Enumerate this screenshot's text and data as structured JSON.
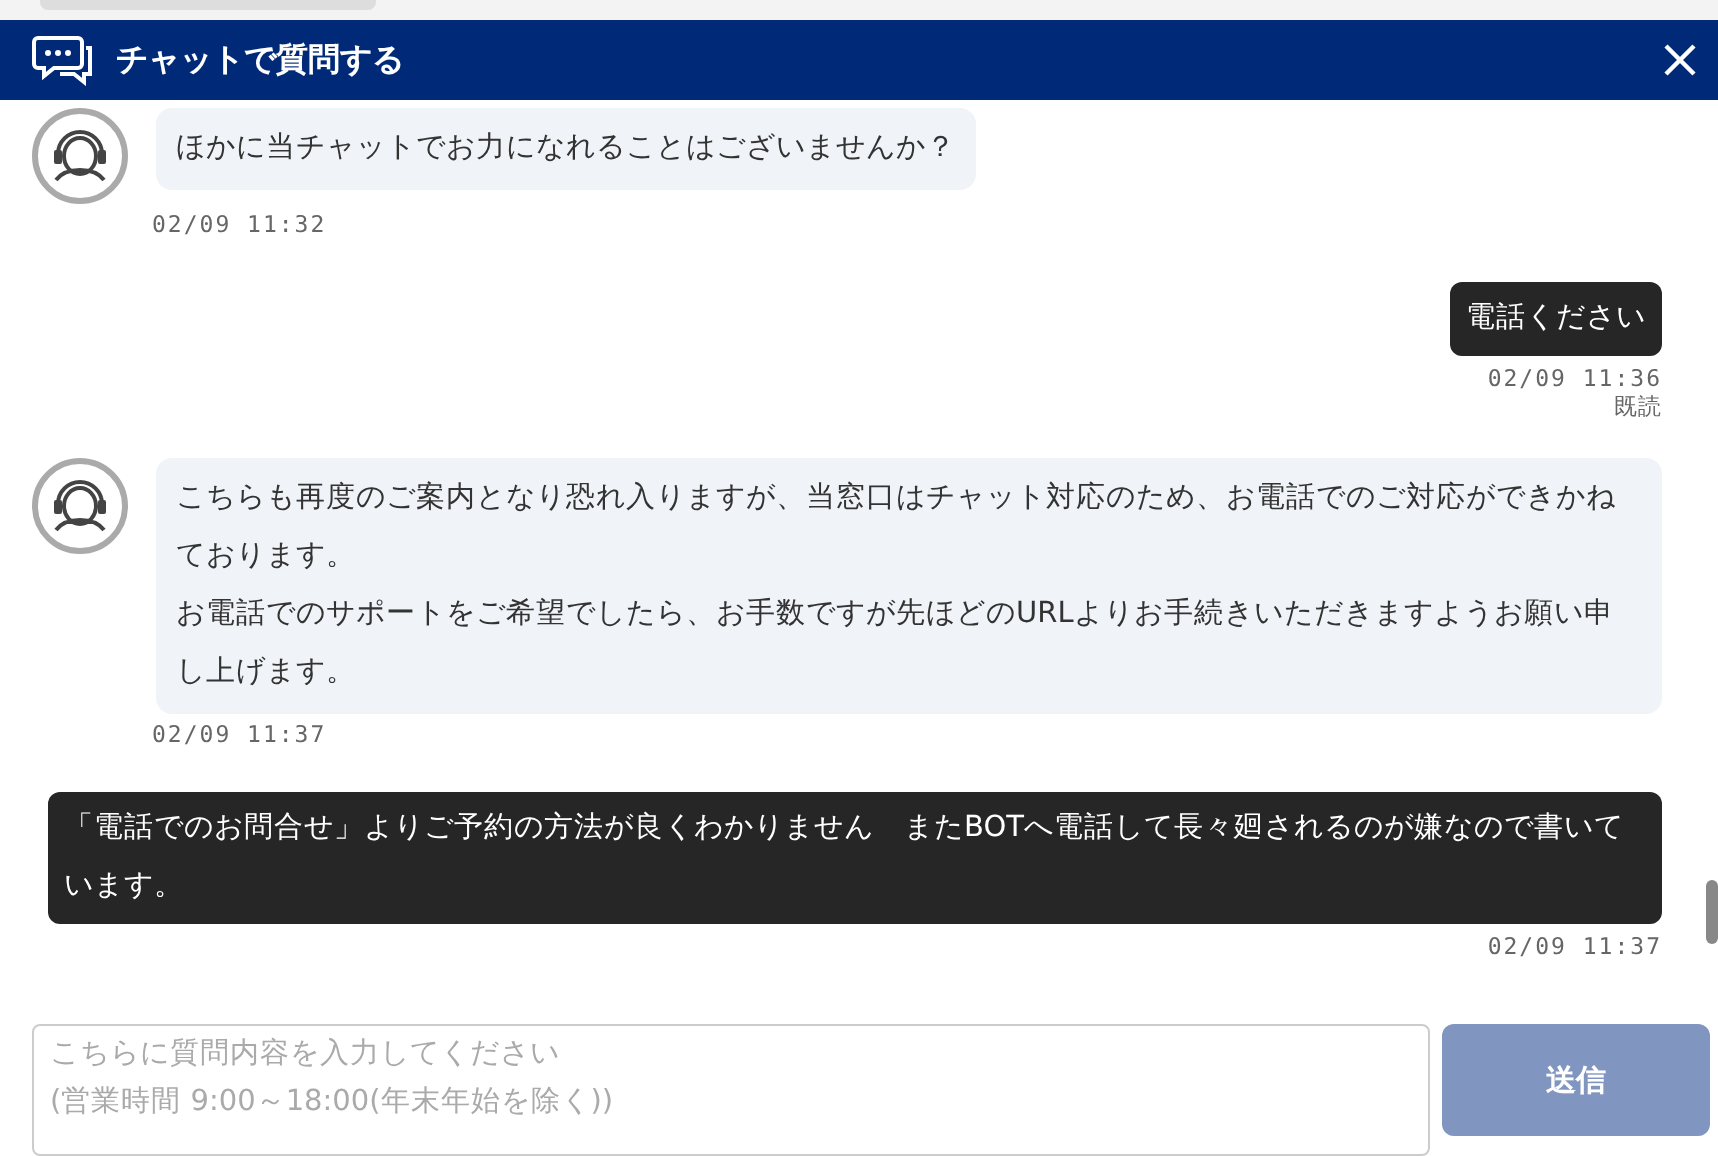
{
  "header": {
    "title": "チャットで質問する"
  },
  "messages": [
    {
      "kind": "bot",
      "paragraphs": [
        "ほかに当チャットでお力になれることはございませんか？"
      ],
      "time": "02/09 11:32"
    },
    {
      "kind": "user",
      "text": "電話ください",
      "time": "02/09 11:36",
      "read_label": "既読"
    },
    {
      "kind": "bot",
      "paragraphs": [
        "こちらも再度のご案内となり恐れ入りますが、当窓口はチャット対応のため、お電話でのご対応ができかねております。",
        "お電話でのサポートをご希望でしたら、お手数ですが先ほどのURLよりお手続きいただきますようお願い申し上げます。"
      ],
      "time": "02/09 11:37"
    },
    {
      "kind": "user",
      "text": "「電話でのお問合せ」よりご予約の方法が良くわかりません　またBOTへ電話して長々廻されるのが嫌なので書いています。",
      "time": "02/09 11:37"
    }
  ],
  "composer": {
    "placeholder": "こちらに質問内容を入力してください\n(営業時間 9:00～18:00(年末年始を除く))",
    "send_label": "送信"
  }
}
